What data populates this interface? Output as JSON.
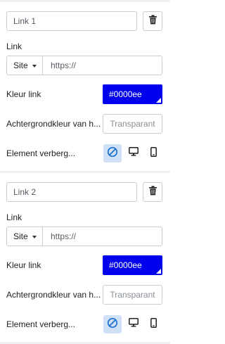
{
  "links": [
    {
      "name_value": "Link 1",
      "link_label": "Link",
      "link_type": "Site",
      "url_placeholder": "https://",
      "color_label": "Kleur link",
      "color_value": "#0000ee",
      "bg_label": "Achtergrondkleur van h...",
      "bg_value": "Transparant",
      "hide_label": "Element verberg..."
    },
    {
      "name_value": "Link 2",
      "link_label": "Link",
      "link_type": "Site",
      "url_placeholder": "https://",
      "color_label": "Kleur link",
      "color_value": "#0000ee",
      "bg_label": "Achtergrondkleur van h...",
      "bg_value": "Transparant",
      "hide_label": "Element verberg..."
    }
  ],
  "icons": {
    "delete": "trash-icon",
    "type_dropdown": "caret-down-icon",
    "hide_everywhere": "no-visibility-icon",
    "desktop": "desktop-icon",
    "mobile": "mobile-icon"
  },
  "colors": {
    "link_color": "#0000ee",
    "active_toggle": "#cfe0f7",
    "accent": "#1a6fd1"
  }
}
